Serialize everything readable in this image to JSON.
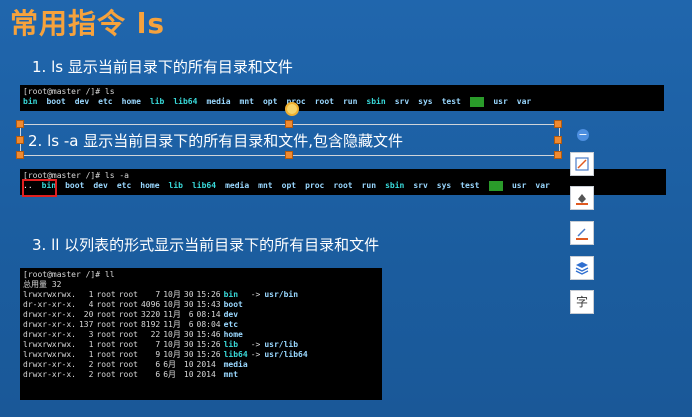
{
  "slide": {
    "title": "常用指令   ls",
    "heading1": "1. ls  显示当前目录下的所有目录和文件",
    "heading2": "2. ls  -a  显示当前目录下的所有目录和文件,包含隐藏文件",
    "heading3": "3. ll   以列表的形式显示当前目录下的所有目录和文件"
  },
  "terminal1": {
    "prompt": "[root@master /]# ls",
    "items": [
      "bin",
      "boot",
      "dev",
      "etc",
      "home",
      "lib",
      "lib64",
      "media",
      "mnt",
      "opt",
      "proc",
      "root",
      "run",
      "sbin",
      "srv",
      "sys",
      "test",
      "tmp",
      "usr",
      "var"
    ]
  },
  "terminal2": {
    "prompt": "[root@master /]# ls -a",
    "items": [
      "..",
      "bin",
      "boot",
      "dev",
      "etc",
      "home",
      "lib",
      "lib64",
      "media",
      "mnt",
      "opt",
      "proc",
      "root",
      "run",
      "sbin",
      "srv",
      "sys",
      "test",
      "tmp",
      "usr",
      "var"
    ]
  },
  "terminal3": {
    "prompt": "[root@master /]# ll",
    "total": "总用量 32",
    "rows": [
      {
        "perm": "lrwxrwxrwx.",
        "links": "1",
        "user": "root",
        "group": "root",
        "size": "7",
        "month": "10月",
        "day": "30",
        "time": "15:26",
        "name": "bin",
        "target": "usr/bin"
      },
      {
        "perm": "dr-xr-xr-x.",
        "links": "4",
        "user": "root",
        "group": "root",
        "size": "4096",
        "month": "10月",
        "day": "30",
        "time": "15:43",
        "name": "boot",
        "target": ""
      },
      {
        "perm": "drwxr-xr-x.",
        "links": "20",
        "user": "root",
        "group": "root",
        "size": "3220",
        "month": "11月",
        "day": "6",
        "time": "08:14",
        "name": "dev",
        "target": ""
      },
      {
        "perm": "drwxr-xr-x.",
        "links": "137",
        "user": "root",
        "group": "root",
        "size": "8192",
        "month": "11月",
        "day": "6",
        "time": "08:04",
        "name": "etc",
        "target": ""
      },
      {
        "perm": "drwxr-xr-x.",
        "links": "3",
        "user": "root",
        "group": "root",
        "size": "22",
        "month": "10月",
        "day": "30",
        "time": "15:46",
        "name": "home",
        "target": ""
      },
      {
        "perm": "lrwxrwxrwx.",
        "links": "1",
        "user": "root",
        "group": "root",
        "size": "7",
        "month": "10月",
        "day": "30",
        "time": "15:26",
        "name": "lib",
        "target": "usr/lib"
      },
      {
        "perm": "lrwxrwxrwx.",
        "links": "1",
        "user": "root",
        "group": "root",
        "size": "9",
        "month": "10月",
        "day": "30",
        "time": "15:26",
        "name": "lib64",
        "target": "usr/lib64"
      },
      {
        "perm": "drwxr-xr-x.",
        "links": "2",
        "user": "root",
        "group": "root",
        "size": "6",
        "month": "6月",
        "day": "10",
        "time": "2014",
        "name": "media",
        "target": ""
      },
      {
        "perm": "drwxr-xr-x.",
        "links": "2",
        "user": "root",
        "group": "root",
        "size": "6",
        "month": "6月",
        "day": "10",
        "time": "2014",
        "name": "mnt",
        "target": ""
      }
    ],
    "arrow": "->"
  },
  "toolbar": {
    "collapse": "−",
    "icons": [
      "shape-style-icon",
      "shape-fill-icon",
      "shape-outline-icon",
      "layers-icon",
      "text-style-icon"
    ],
    "text_style_glyph": "字"
  },
  "colors": {
    "title": "#f6a23c",
    "highlight": "#2a9b2a",
    "selection_handle": "#f08a30",
    "red_box": "#e02020"
  }
}
